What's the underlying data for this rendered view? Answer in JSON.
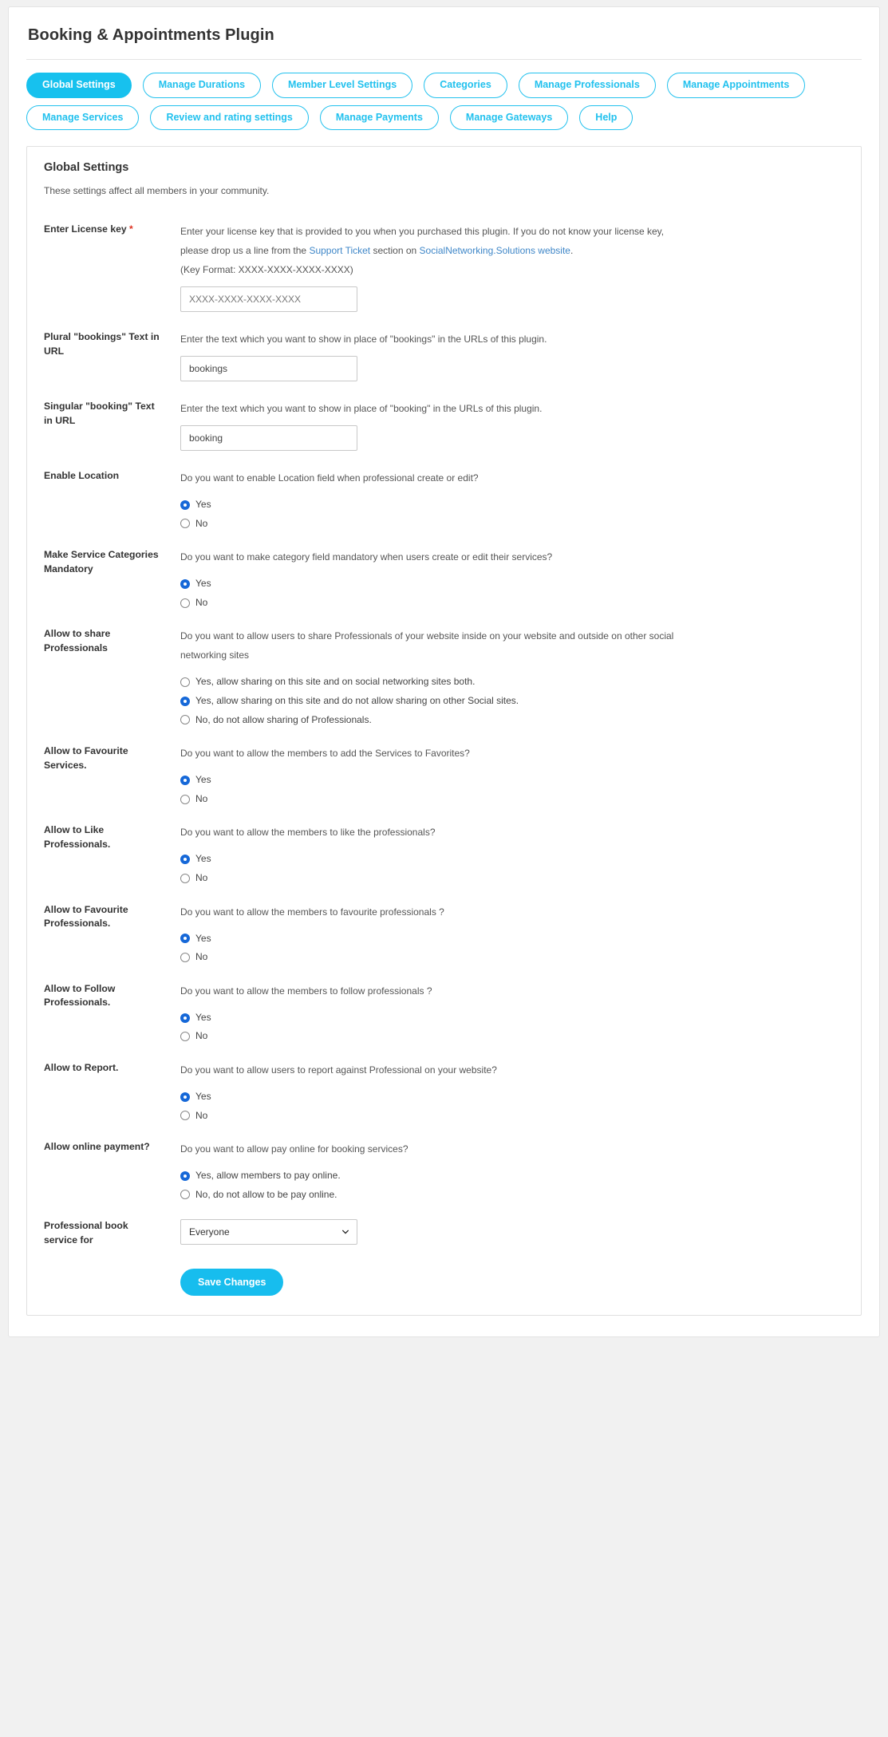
{
  "page": {
    "title": "Booking & Appointments Plugin"
  },
  "tabs": [
    {
      "label": "Global Settings",
      "active": true
    },
    {
      "label": "Manage Durations",
      "active": false
    },
    {
      "label": "Member Level Settings",
      "active": false
    },
    {
      "label": "Categories",
      "active": false
    },
    {
      "label": "Manage Professionals",
      "active": false
    },
    {
      "label": "Manage Appointments",
      "active": false
    },
    {
      "label": "Manage Services",
      "active": false
    },
    {
      "label": "Review and rating settings",
      "active": false
    },
    {
      "label": "Manage Payments",
      "active": false
    },
    {
      "label": "Manage Gateways",
      "active": false
    },
    {
      "label": "Help",
      "active": false
    }
  ],
  "panel": {
    "title": "Global Settings",
    "subtitle": "These settings affect all members in your community."
  },
  "license": {
    "label": "Enter License key",
    "required_mark": "*",
    "desc_part1": "Enter your license key that is provided to you when you purchased this plugin. If you do not know your license key, please drop us a line from the ",
    "link1": "Support Ticket",
    "desc_part2": " section on ",
    "link2": "SocialNetworking.Solutions website",
    "desc_part3": ".",
    "key_format": "(Key Format: XXXX-XXXX-XXXX-XXXX)",
    "placeholder": "XXXX-XXXX-XXXX-XXXX",
    "value": ""
  },
  "plural_url": {
    "label": "Plural \"bookings\" Text in URL",
    "desc": "Enter the text which you want to show in place of \"bookings\" in the URLs of this plugin.",
    "value": "bookings"
  },
  "singular_url": {
    "label": "Singular \"booking\" Text in URL",
    "desc": "Enter the text which you want to show in place of \"booking\" in the URLs of this plugin.",
    "value": "booking"
  },
  "enable_location": {
    "label": "Enable Location",
    "desc": "Do you want to enable Location field when professional create or edit?",
    "options": [
      {
        "label": "Yes",
        "checked": true
      },
      {
        "label": "No",
        "checked": false
      }
    ]
  },
  "service_categories_mandatory": {
    "label": "Make Service Categories Mandatory",
    "desc": "Do you want to make category field mandatory when users create or edit their services?",
    "options": [
      {
        "label": "Yes",
        "checked": true
      },
      {
        "label": "No",
        "checked": false
      }
    ]
  },
  "share_professionals": {
    "label": "Allow to share Professionals",
    "desc": "Do you want to allow users to share Professionals of your website inside on your website and outside on other social networking sites",
    "options": [
      {
        "label": "Yes, allow sharing on this site and on social networking sites both.",
        "checked": false
      },
      {
        "label": "Yes, allow sharing on this site and do not allow sharing on other Social sites.",
        "checked": true
      },
      {
        "label": "No, do not allow sharing of Professionals.",
        "checked": false
      }
    ]
  },
  "favourite_services": {
    "label": "Allow to Favourite Services.",
    "desc": "Do you want to allow the members to add the Services to Favorites?",
    "options": [
      {
        "label": "Yes",
        "checked": true
      },
      {
        "label": "No",
        "checked": false
      }
    ]
  },
  "like_professionals": {
    "label": "Allow to Like Professionals.",
    "desc": "Do you want to allow the members to like the professionals?",
    "options": [
      {
        "label": "Yes",
        "checked": true
      },
      {
        "label": "No",
        "checked": false
      }
    ]
  },
  "favourite_professionals": {
    "label": "Allow to Favourite Professionals.",
    "desc": "Do you want to allow the members to favourite professionals ?",
    "options": [
      {
        "label": "Yes",
        "checked": true
      },
      {
        "label": "No",
        "checked": false
      }
    ]
  },
  "follow_professionals": {
    "label": "Allow to Follow Professionals.",
    "desc": "Do you want to allow the members to follow professionals ?",
    "options": [
      {
        "label": "Yes",
        "checked": true
      },
      {
        "label": "No",
        "checked": false
      }
    ]
  },
  "allow_report": {
    "label": "Allow to Report.",
    "desc": "Do you want to allow users to report against Professional on your website?",
    "options": [
      {
        "label": "Yes",
        "checked": true
      },
      {
        "label": "No",
        "checked": false
      }
    ]
  },
  "online_payment": {
    "label": "Allow online payment?",
    "desc": "Do you want to allow pay online for booking services?",
    "options": [
      {
        "label": "Yes, allow members to pay online.",
        "checked": true
      },
      {
        "label": "No, do not allow to be pay online.",
        "checked": false
      }
    ]
  },
  "book_service_for": {
    "label": "Professional book service for",
    "selected": "Everyone"
  },
  "save": {
    "label": "Save Changes"
  },
  "colors": {
    "accent": "#17c1ee",
    "radio_checked": "#1668d8",
    "link": "#3f87c8",
    "required": "#dd3322"
  }
}
